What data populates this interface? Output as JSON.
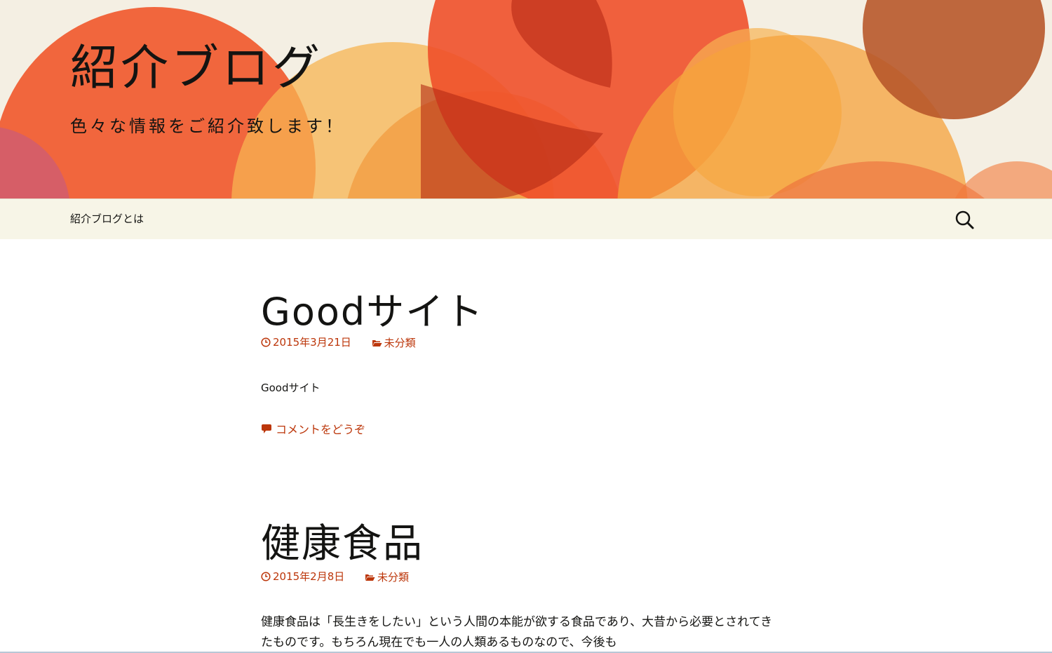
{
  "header": {
    "site_title": "紹介ブログ",
    "site_description": "色々な情報をご紹介致します！"
  },
  "nav": {
    "items": [
      {
        "label": "紹介ブログとは"
      }
    ],
    "search_icon": "search-icon"
  },
  "posts": [
    {
      "title": "Goodサイト",
      "date": "2015年3月21日",
      "category": "未分類",
      "excerpt": "Goodサイト",
      "comments_link": "コメントをどうぞ"
    },
    {
      "title": "健康食品",
      "date": "2015年2月8日",
      "category": "未分類",
      "body": "健康食品は「長生きをしたい」という人間の本能が欲する食品であり、大昔から必要とされてきたものです。もちろん現在でも一人の人類あるものなので、今後も"
    }
  ],
  "colors": {
    "accent": "#bc360a",
    "header_bg": "#f4efe3",
    "navbar_bg": "#f7f5e7",
    "text": "#141412"
  }
}
